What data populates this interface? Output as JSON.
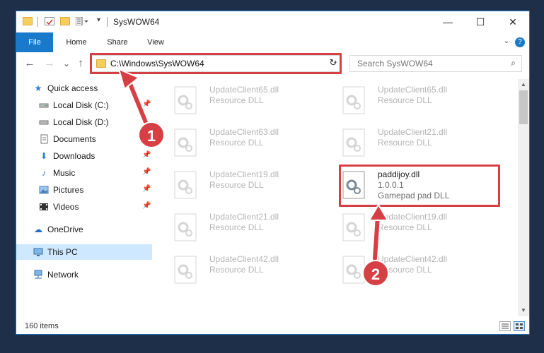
{
  "window": {
    "title": "SysWOW64",
    "accent_color": "#1979ca"
  },
  "title_bar": {
    "minimize_label": "—",
    "maximize_label": "☐",
    "close_label": "✕"
  },
  "ribbon": {
    "tabs": [
      {
        "label": "File"
      },
      {
        "label": "Home"
      },
      {
        "label": "Share"
      },
      {
        "label": "View"
      }
    ],
    "help_label": "?"
  },
  "navigation": {
    "back_label": "←",
    "forward_label": "→",
    "recent_label": "⌄",
    "up_label": "↑"
  },
  "address_bar": {
    "path": "C:\\Windows\\SysWOW64"
  },
  "search": {
    "placeholder": "Search SysWOW64"
  },
  "sidebar": {
    "items": [
      {
        "label": "Quick access",
        "icon": "star-icon",
        "pinned": false
      },
      {
        "label": "Local Disk (C:)",
        "icon": "drive-icon",
        "pinned": true
      },
      {
        "label": "Local Disk (D:)",
        "icon": "drive-icon",
        "pinned": false
      },
      {
        "label": "Documents",
        "icon": "documents-icon",
        "pinned": true
      },
      {
        "label": "Downloads",
        "icon": "download-icon",
        "pinned": true
      },
      {
        "label": "Music",
        "icon": "music-icon",
        "pinned": true
      },
      {
        "label": "Pictures",
        "icon": "pictures-icon",
        "pinned": true
      },
      {
        "label": "Videos",
        "icon": "videos-icon",
        "pinned": true
      },
      {
        "label": "OneDrive",
        "icon": "cloud-icon",
        "pinned": false
      },
      {
        "label": "This PC",
        "icon": "computer-icon",
        "pinned": false,
        "selected": true
      },
      {
        "label": "Network",
        "icon": "network-icon",
        "pinned": false
      }
    ]
  },
  "files": [
    {
      "name": "UpdateClient65.dll",
      "type": "Resource DLL"
    },
    {
      "name": "UpdateClient65.dll",
      "type": "Resource DLL"
    },
    {
      "name": "UpdateClient63.dll",
      "type": "Resource DLL"
    },
    {
      "name": "UpdateClient21.dll",
      "type": "Resource DLL"
    },
    {
      "name": "UpdateClient19.dll",
      "type": "Resource DLL"
    },
    {
      "name": "paddijoy.dll",
      "version": "1.0.0.1",
      "description": "Gamepad pad DLL",
      "highlighted": true
    },
    {
      "name": "UpdateClient21.dll",
      "type": "Resource DLL"
    },
    {
      "name": "UpdateClient19.dll",
      "type": "Resource DLL"
    },
    {
      "name": "UpdateClient42.dll",
      "type": "Resource DLL"
    },
    {
      "name": "UpdateClient42.dll",
      "type": "Resource DLL"
    }
  ],
  "status_bar": {
    "item_count": "160 items"
  },
  "callouts": [
    {
      "number": "1"
    },
    {
      "number": "2"
    }
  ],
  "highlight_color": "#d64044"
}
